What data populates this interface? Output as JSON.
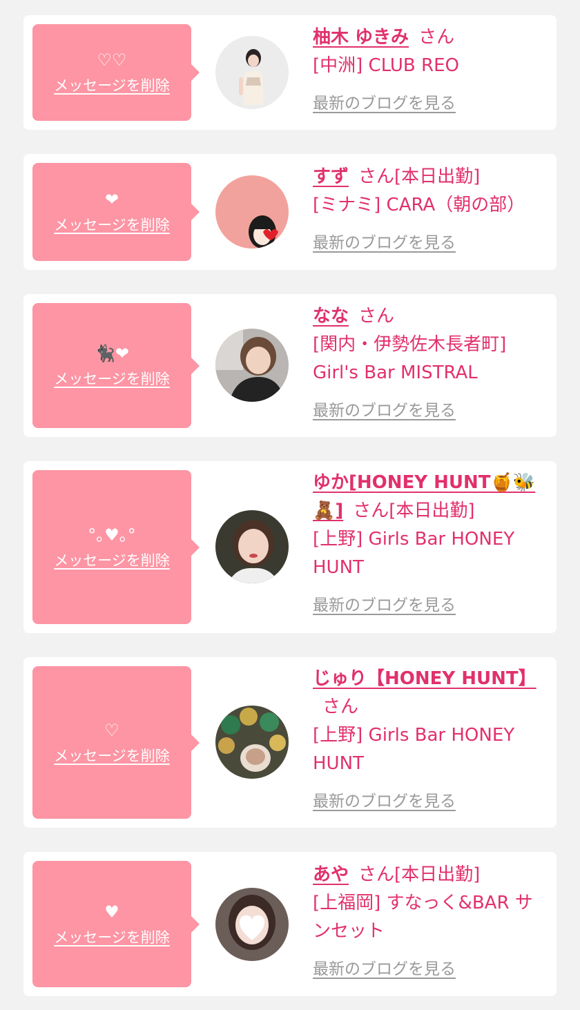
{
  "delete_label": "メッセージを削除",
  "blog_label": "最新のブログを見る",
  "suffix": "さん",
  "colors": {
    "background": "#f2f2f2",
    "card": "#ffffff",
    "bubble": "#fd95a4",
    "accent": "#e1306c",
    "muted": "#999999"
  },
  "cards": [
    {
      "message": "♡♡",
      "name": "柚木 ゆきみ",
      "status": "",
      "shop": "[中洲] CLUB REO",
      "avatar": "photo-woman-white-dress"
    },
    {
      "message": "❤",
      "name": "すず",
      "status": "[本日出勤]",
      "shop": "[ミナミ] CARA（朝の部）",
      "avatar": "illustration-girl-heart"
    },
    {
      "message": "🐈‍⬛❤",
      "name": "なな",
      "status": "",
      "shop": "[関内・伊勢佐木長者町] Girl's Bar MISTRAL",
      "avatar": "photo-woman-selfie"
    },
    {
      "message": "°｡♥｡°",
      "name": "ゆか[HONEY HUNT🍯🐝🧸]",
      "status": "[本日出勤]",
      "shop": "[上野] Girls Bar HONEY HUNT",
      "avatar": "photo-woman-closeup"
    },
    {
      "message": "♡",
      "name": "じゅり【HONEY HUNT】",
      "status": "",
      "shop": "[上野] Girls Bar HONEY HUNT",
      "avatar": "photo-balloons"
    },
    {
      "message": "♥",
      "name": "あや",
      "status": "[本日出勤]",
      "shop": "[上福岡] すなっく&BAR サンセット",
      "avatar": "photo-woman-heart-sticker"
    }
  ]
}
